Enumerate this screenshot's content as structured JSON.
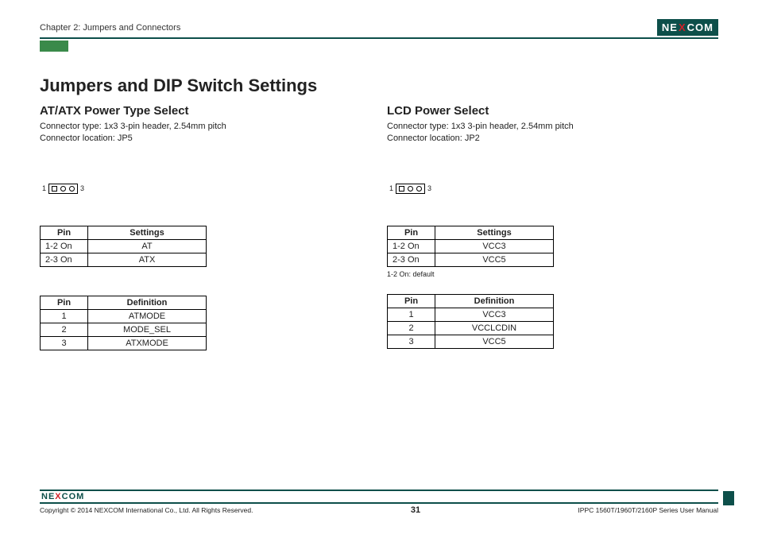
{
  "header": {
    "chapter": "Chapter 2: Jumpers and Connectors",
    "logo_text_pre": "NE",
    "logo_text_x": "X",
    "logo_text_post": "COM"
  },
  "main": {
    "title": "Jumpers and DIP Switch Settings"
  },
  "left": {
    "heading": "AT/ATX Power Type Select",
    "connector_type": "Connector type: 1x3 3-pin header, 2.54mm pitch",
    "connector_location": "Connector location: JP5",
    "pin_left": "1",
    "pin_right": "3",
    "settings_table": {
      "head_pin": "Pin",
      "head_set": "Settings",
      "rows": [
        {
          "pin": "1-2 On",
          "val": "AT"
        },
        {
          "pin": "2-3 On",
          "val": "ATX"
        }
      ]
    },
    "def_table": {
      "head_pin": "Pin",
      "head_def": "Definition",
      "rows": [
        {
          "pin": "1",
          "val": "ATMODE"
        },
        {
          "pin": "2",
          "val": "MODE_SEL"
        },
        {
          "pin": "3",
          "val": "ATXMODE"
        }
      ]
    }
  },
  "right": {
    "heading": "LCD Power Select",
    "connector_type": "Connector type: 1x3 3-pin header, 2.54mm pitch",
    "connector_location": "Connector location: JP2",
    "pin_left": "1",
    "pin_right": "3",
    "settings_table": {
      "head_pin": "Pin",
      "head_set": "Settings",
      "rows": [
        {
          "pin": "1-2 On",
          "val": "VCC3"
        },
        {
          "pin": "2-3 On",
          "val": "VCC5"
        }
      ]
    },
    "note": "1-2 On: default",
    "def_table": {
      "head_pin": "Pin",
      "head_def": "Definition",
      "rows": [
        {
          "pin": "1",
          "val": "VCC3"
        },
        {
          "pin": "2",
          "val": "VCCLCDIN"
        },
        {
          "pin": "3",
          "val": "VCC5"
        }
      ]
    }
  },
  "footer": {
    "copyright": "Copyright © 2014 NEXCOM International Co., Ltd. All Rights Reserved.",
    "page": "31",
    "manual": "IPPC 1560T/1960T/2160P Series User Manual"
  }
}
